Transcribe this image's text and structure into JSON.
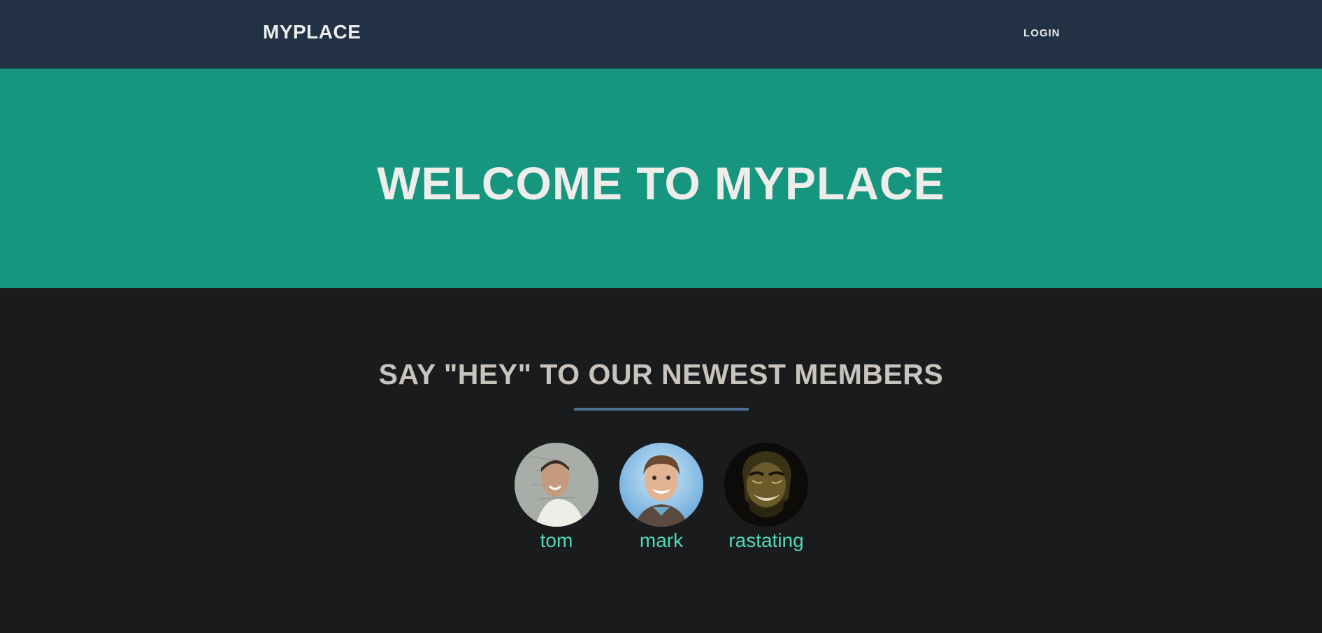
{
  "nav": {
    "brand": "MYPLACE",
    "login": "LOGIN"
  },
  "hero": {
    "title": "WELCOME TO MYPLACE"
  },
  "members_section": {
    "title": "SAY \"HEY\" TO OUR NEWEST MEMBERS",
    "members": [
      {
        "name": "tom",
        "avatar": "profile-photo-tom"
      },
      {
        "name": "mark",
        "avatar": "profile-photo-mark"
      },
      {
        "name": "rastating",
        "avatar": "profile-photo-rastating"
      }
    ]
  },
  "colors": {
    "navbar": "#223244",
    "hero": "#16967e",
    "background": "#1a1b1d",
    "accent_link": "#4fd9b9",
    "divider": "#4a6f91"
  }
}
